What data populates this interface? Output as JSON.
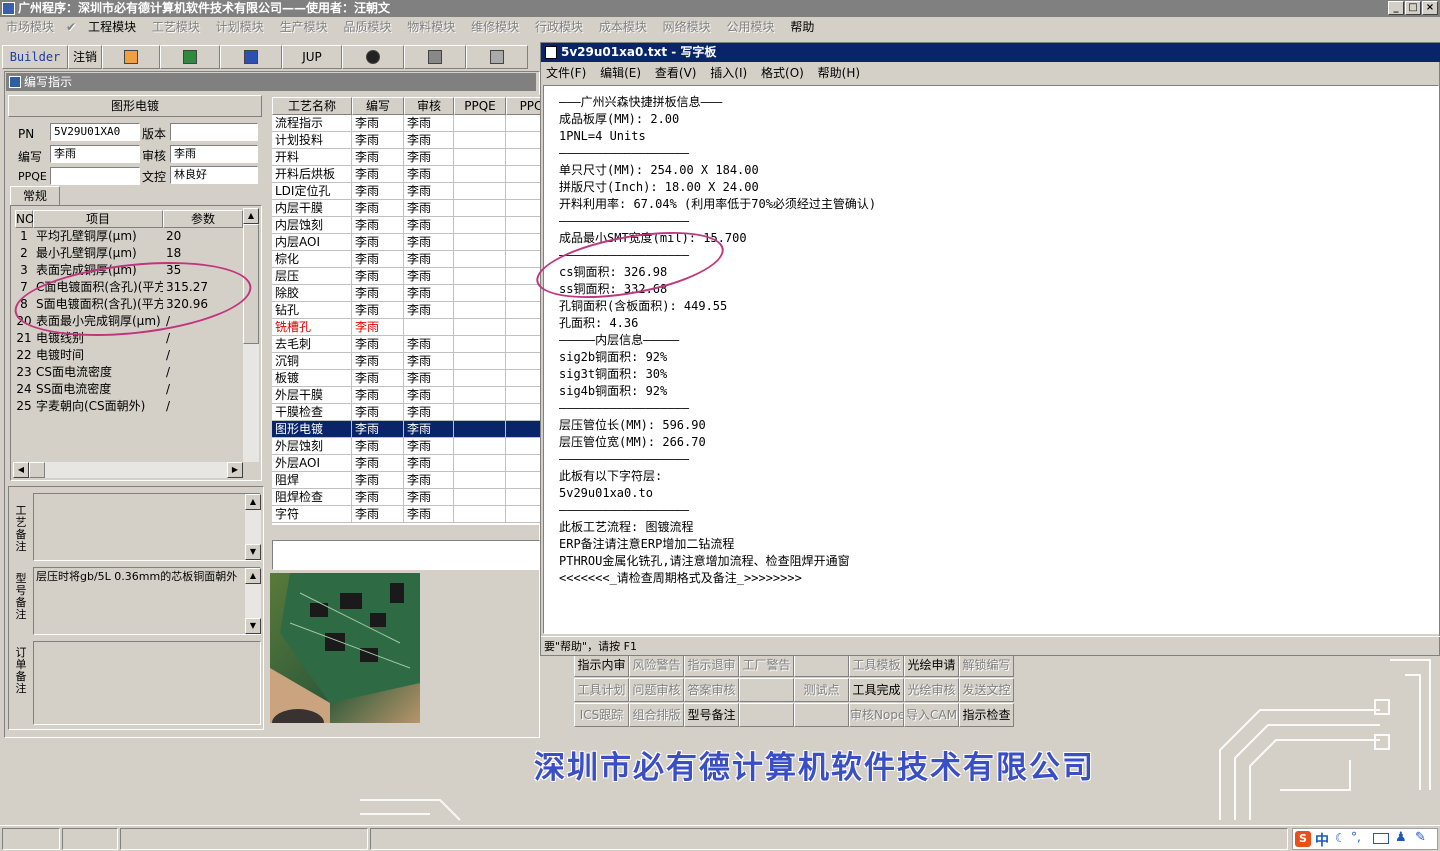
{
  "window": {
    "title": "广州程序：深圳市必有德计算机软件技术有限公司——使用者：汪朝文",
    "controls": [
      "_",
      "□",
      "×"
    ]
  },
  "menu": [
    "市场模块",
    "工程模块",
    "工艺模块",
    "计划模块",
    "生产模块",
    "品质模块",
    "物料模块",
    "维修模块",
    "行政模块",
    "成本模块",
    "网络模块",
    "公用模块",
    "帮助"
  ],
  "toolbar": {
    "builder": "Builder",
    "logout": "注销",
    "jup": "JUP"
  },
  "panel": {
    "title": "编写指示",
    "process_name": "图形电镀",
    "labels": {
      "pn": "PN",
      "version": "版本",
      "writer": "编写",
      "reviewer": "审核",
      "ppqe": "PPQE",
      "doc_control": "文控"
    },
    "values": {
      "pn": "5V29U01XA0",
      "version": "",
      "writer": "李雨",
      "reviewer": "李雨",
      "ppqe": "",
      "doc_control": "林良好"
    },
    "tab": "常规"
  },
  "param_table": {
    "headers": [
      "NO",
      "项目",
      "参数"
    ],
    "rows": [
      {
        "no": "1",
        "item": "平均孔壁铜厚(μm)",
        "value": "20"
      },
      {
        "no": "2",
        "item": "最小孔壁铜厚(μm)",
        "value": "18"
      },
      {
        "no": "3",
        "item": "表面完成铜厚(μm)",
        "value": "35"
      },
      {
        "no": "7",
        "item": "C面电镀面积(含孔)(平方",
        "value": "315.27"
      },
      {
        "no": "8",
        "item": "S面电镀面积(含孔)(平方",
        "value": "320.96"
      },
      {
        "no": "20",
        "item": "表面最小完成铜厚(μm)",
        "value": "/"
      },
      {
        "no": "21",
        "item": "电镀线别",
        "value": "/"
      },
      {
        "no": "22",
        "item": "电镀时间",
        "value": "/"
      },
      {
        "no": "23",
        "item": "CS面电流密度",
        "value": "/"
      },
      {
        "no": "24",
        "item": "SS面电流密度",
        "value": "/"
      },
      {
        "no": "25",
        "item": "字麦朝向(CS面朝外)",
        "value": "/"
      }
    ]
  },
  "remarks": {
    "process_label": "工艺备注",
    "model_label": "型号备注",
    "order_label": "订单备注",
    "process_text": "",
    "model_text": "层压时将gb/5L 0.36mm的芯板铜面朝外",
    "order_text": ""
  },
  "process_table": {
    "headers": [
      "工艺名称",
      "编写",
      "审核",
      "PPQE",
      "PPC"
    ],
    "rows": [
      {
        "name": "流程指示",
        "writer": "李雨",
        "reviewer": "李雨"
      },
      {
        "name": "计划投料",
        "writer": "李雨",
        "reviewer": "李雨"
      },
      {
        "name": "开料",
        "writer": "李雨",
        "reviewer": "李雨"
      },
      {
        "name": "开料后烘板",
        "writer": "李雨",
        "reviewer": "李雨"
      },
      {
        "name": "LDI定位孔",
        "writer": "李雨",
        "reviewer": "李雨"
      },
      {
        "name": "内层干膜",
        "writer": "李雨",
        "reviewer": "李雨"
      },
      {
        "name": "内层蚀刻",
        "writer": "李雨",
        "reviewer": "李雨"
      },
      {
        "name": "内层AOI",
        "writer": "李雨",
        "reviewer": "李雨"
      },
      {
        "name": "棕化",
        "writer": "李雨",
        "reviewer": "李雨"
      },
      {
        "name": "层压",
        "writer": "李雨",
        "reviewer": "李雨"
      },
      {
        "name": "除胶",
        "writer": "李雨",
        "reviewer": "李雨"
      },
      {
        "name": "钻孔",
        "writer": "李雨",
        "reviewer": "李雨"
      },
      {
        "name": "铣槽孔",
        "writer": "李雨",
        "reviewer": ""
      },
      {
        "name": "去毛刺",
        "writer": "李雨",
        "reviewer": "李雨"
      },
      {
        "name": "沉铜",
        "writer": "李雨",
        "reviewer": "李雨"
      },
      {
        "name": "板镀",
        "writer": "李雨",
        "reviewer": "李雨"
      },
      {
        "name": "外层干膜",
        "writer": "李雨",
        "reviewer": "李雨"
      },
      {
        "name": "干膜检查",
        "writer": "李雨",
        "reviewer": "李雨"
      },
      {
        "name": "图形电镀",
        "writer": "李雨",
        "reviewer": "李雨"
      },
      {
        "name": "外层蚀刻",
        "writer": "李雨",
        "reviewer": "李雨"
      },
      {
        "name": "外层AOI",
        "writer": "李雨",
        "reviewer": "李雨"
      },
      {
        "name": "阻焊",
        "writer": "李雨",
        "reviewer": "李雨"
      },
      {
        "name": "阻焊检查",
        "writer": "李雨",
        "reviewer": "李雨"
      },
      {
        "name": "字符",
        "writer": "李雨",
        "reviewer": "李雨"
      }
    ],
    "selected_index": 18,
    "red_index": 12
  },
  "wordpad": {
    "title": "5v29u01xa0.txt - 写字板",
    "menu": [
      "文件(F)",
      "编辑(E)",
      "查看(V)",
      "插入(I)",
      "格式(O)",
      "帮助(H)"
    ],
    "lines": [
      "———广州兴森快捷拼板信息———",
      "成品板厚(MM): 2.00",
      "1PNL=4 Units",
      "——————————————————",
      "单只尺寸(MM): 254.00 X 184.00",
      "拼版尺寸(Inch): 18.00 X 24.00",
      "开料利用率: 67.04% (利用率低于70%必须经过主管确认)",
      "——————————————————",
      "成品最小SMT宽度(mil): 15.700",
      "——————————————————",
      "cs铜面积: 326.98",
      "ss铜面积: 332.68",
      "孔铜面积(含板面积): 449.55",
      "孔面积: 4.36",
      "—————内层信息—————",
      "sig2b铜面积: 92%",
      "sig3t铜面积: 30%",
      "sig4b铜面积: 92%",
      "——————————————————",
      "层压管位长(MM): 596.90",
      "层压管位宽(MM): 266.70",
      "——————————————————",
      "此板有以下字符层:",
      "5v29u01xa0.to",
      "——————————————————",
      "此板工艺流程: 图镀流程",
      "ERP备注请注意ERP增加二钻流程",
      "PTHROU金属化铣孔,请注意增加流程、检查阻焊开通窗",
      "<<<<<<<_请检查周期格式及备注_>>>>>>>>"
    ],
    "status": "要\"帮助\"，请按 F1"
  },
  "action_buttons": [
    [
      {
        "label": "指示内审",
        "enabled": true
      },
      {
        "label": "风险警告",
        "enabled": false
      },
      {
        "label": "指示退审",
        "enabled": false
      },
      {
        "label": "工厂警告",
        "enabled": false
      },
      {
        "label": "",
        "enabled": false
      },
      {
        "label": "工具模板",
        "enabled": false
      },
      {
        "label": "光绘申请",
        "enabled": true
      },
      {
        "label": "解锁编写",
        "enabled": false
      }
    ],
    [
      {
        "label": "工具计划",
        "enabled": false
      },
      {
        "label": "问题审核",
        "enabled": false
      },
      {
        "label": "答案审核",
        "enabled": false
      },
      {
        "label": "",
        "enabled": false
      },
      {
        "label": "测试点",
        "enabled": false
      },
      {
        "label": "工具完成",
        "enabled": true
      },
      {
        "label": "光绘审核",
        "enabled": false
      },
      {
        "label": "发送文控",
        "enabled": false
      }
    ],
    [
      {
        "label": "ICS跟踪",
        "enabled": false
      },
      {
        "label": "组合排版",
        "enabled": false
      },
      {
        "label": "型号备注",
        "enabled": true
      },
      {
        "label": "",
        "enabled": false
      },
      {
        "label": "",
        "enabled": false
      },
      {
        "label": "审核Nope",
        "enabled": false
      },
      {
        "label": "导入CAM",
        "enabled": false
      },
      {
        "label": "指示检查",
        "enabled": true
      }
    ]
  ],
  "banner": "深圳市必有德计算机软件技术有限公司",
  "tray": {
    "ime": "中",
    "icons": [
      "sogou-icon",
      "moon-icon",
      "punct-icon",
      "keyboard-icon",
      "settings-icon"
    ]
  },
  "colors": {
    "selection": "#0a246a",
    "banner": "#3b4fc4",
    "annotation": "#c0367e",
    "red_text": "#e00000"
  }
}
